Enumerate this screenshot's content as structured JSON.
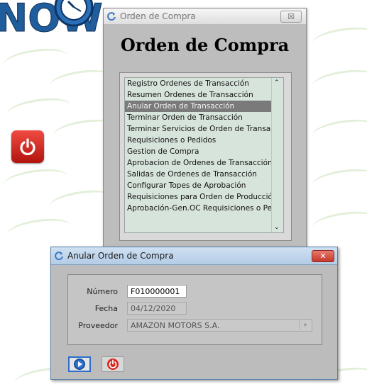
{
  "desktop": {
    "logo_text": "NOW"
  },
  "main_window": {
    "title": "Orden de Compra",
    "close_symbol": "☒",
    "heading": "Orden de Compra",
    "menu_items": [
      "Registro Ordenes de Transacción",
      "Resumen Ordenes de Transacción",
      "Anular Orden de Transacción",
      "Terminar Orden de Transacción",
      "Terminar Servicios de Orden de Transacción",
      "Requisiciones o Pedidos",
      "Gestion de Compra",
      "Aprobacion de Ordenes de Transacción",
      "Salidas de Ordenes de Transacción",
      "Configurar Topes de Aprobación",
      "Requisiciones para Orden de Producción",
      "Aprobación-Gen.OC Requisiciones o Pedidos"
    ],
    "selected_index": 2,
    "scroll_up": "⌃",
    "scroll_down": "⌄"
  },
  "dialog": {
    "title": "Anular Orden de Compra",
    "close_symbol": "✕",
    "numero_label": "Número",
    "numero_value": "F010000001",
    "fecha_label": "Fecha",
    "fecha_value": "04/12/2020",
    "proveedor_label": "Proveedor",
    "proveedor_value": "AMAZON MOTORS S.A.",
    "combo_arrow": "▾"
  },
  "icons": {
    "app_icon": "refresh-icon",
    "go_icon": "play-icon",
    "cancel_icon": "power-icon",
    "desktop_icon": "power-icon"
  },
  "colors": {
    "selection": "#7a7a7a",
    "list_bg": "#d7e4dc",
    "go_border": "#2f6fc9",
    "power_red": "#d9241b"
  }
}
